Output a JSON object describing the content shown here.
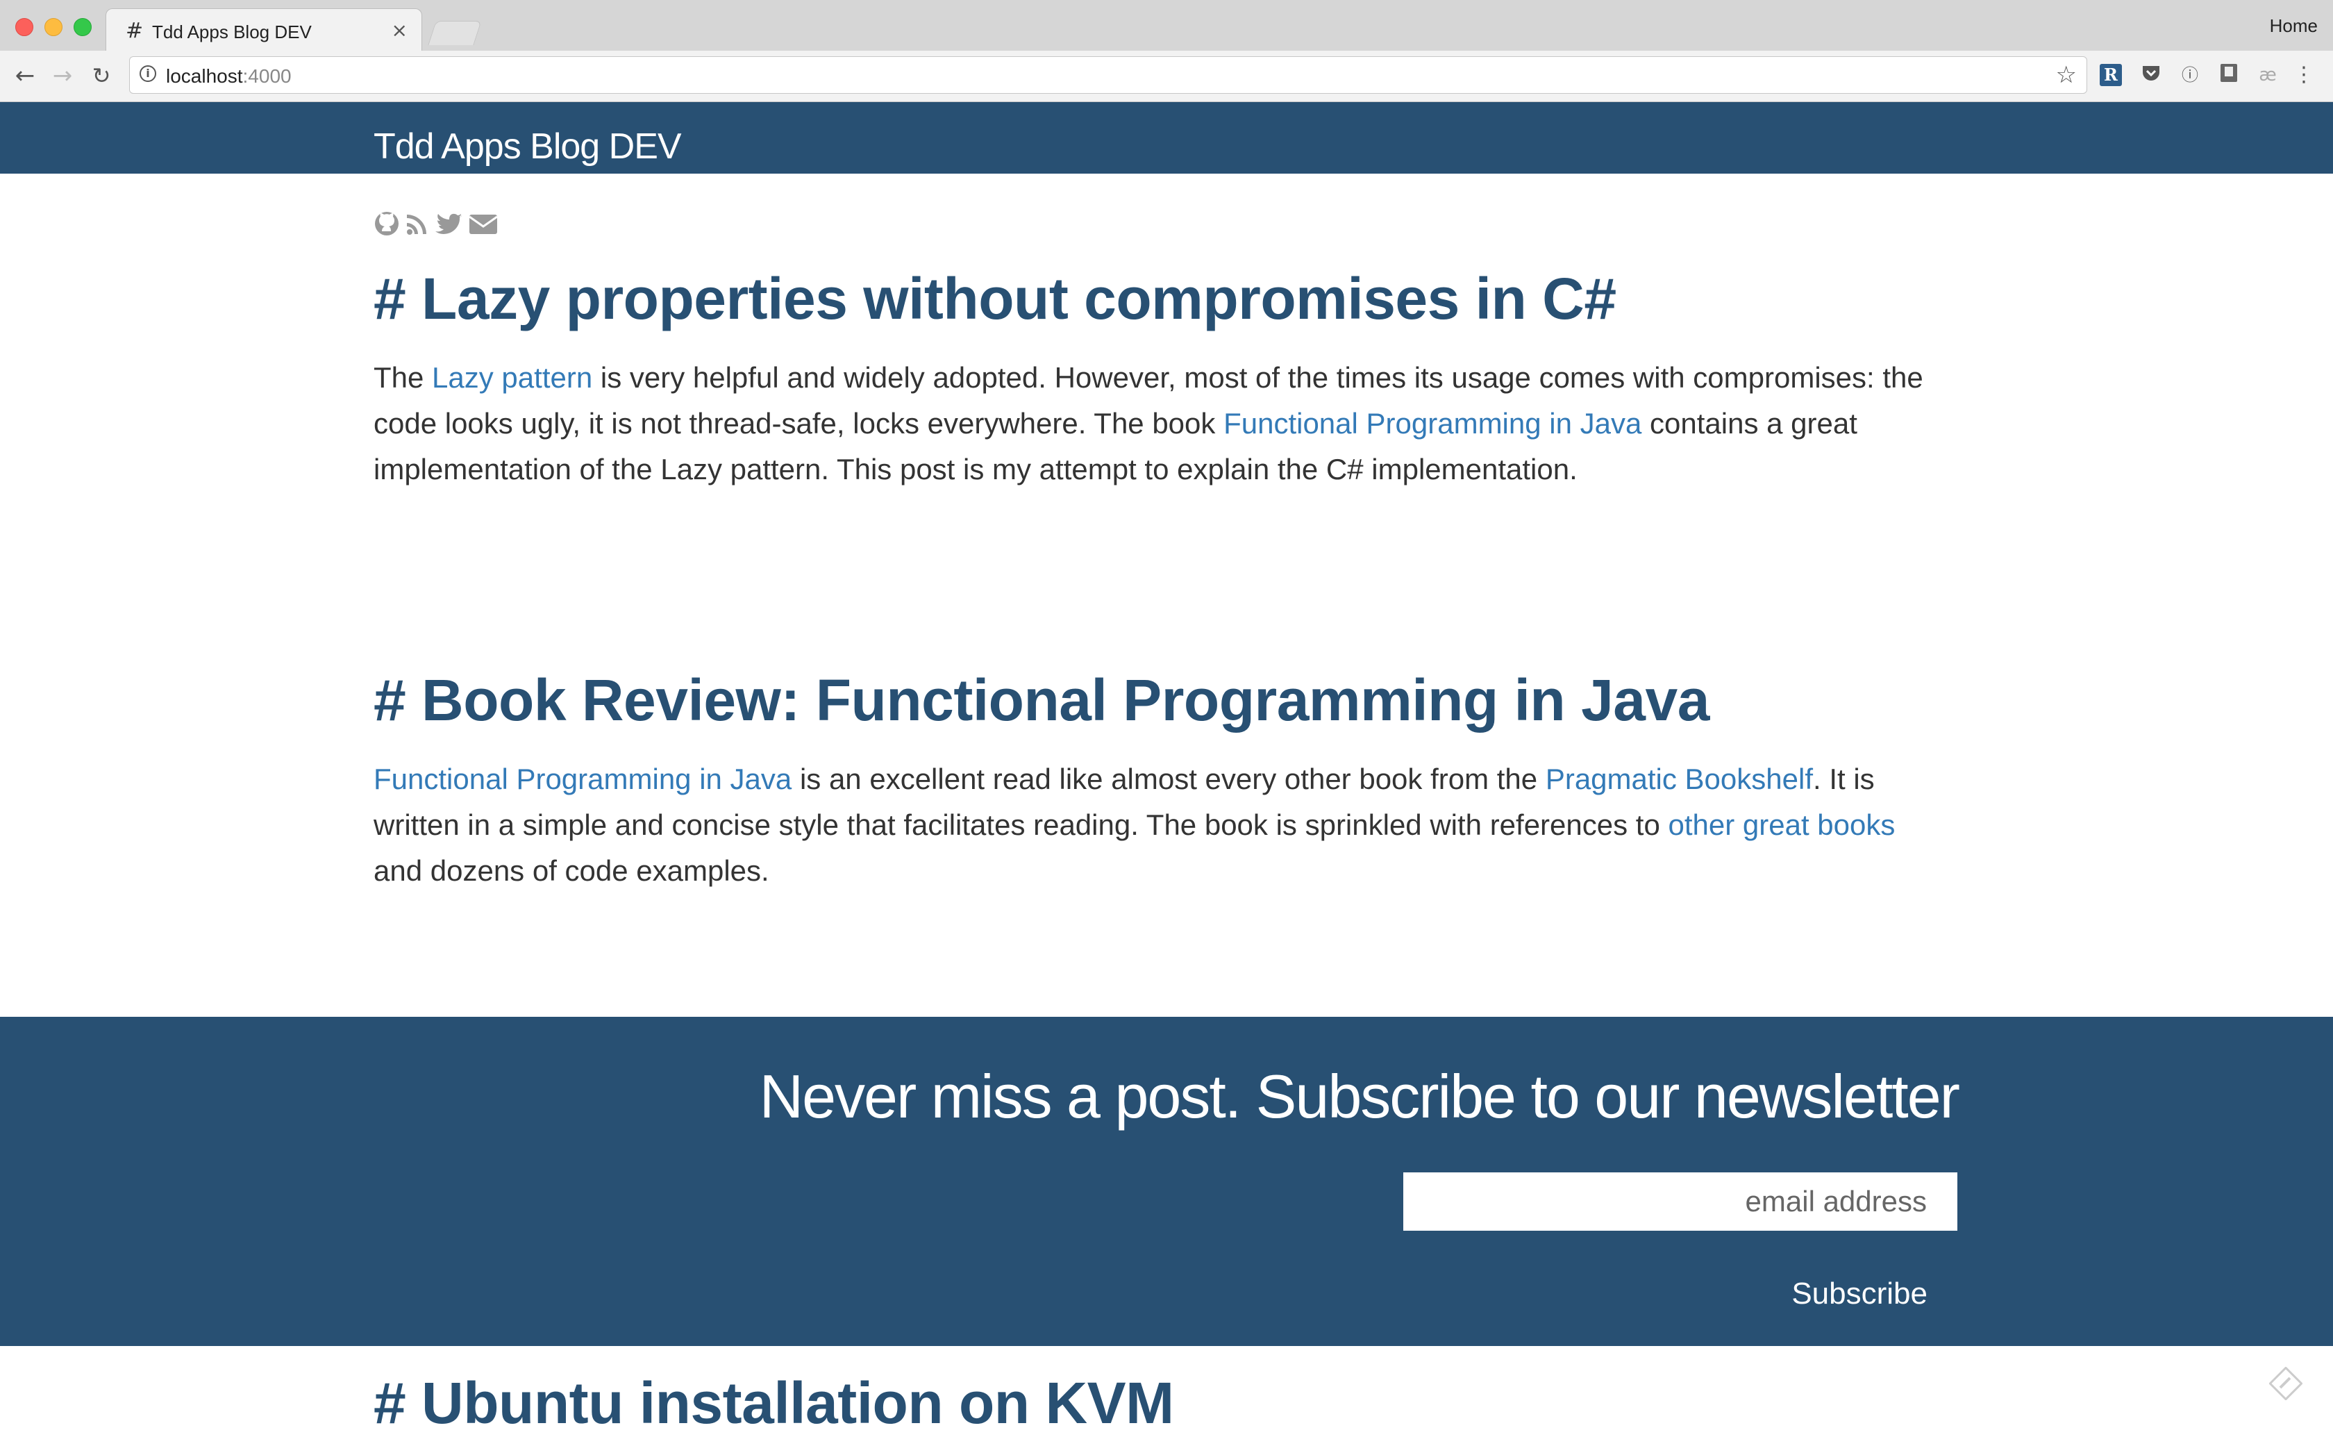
{
  "browser": {
    "tab_favicon": "#",
    "tab_title": "Tdd Apps Blog DEV",
    "tab_close": "×",
    "profile_label": "Home",
    "url_host": "localhost",
    "url_port": ":4000"
  },
  "site": {
    "title": "Tdd Apps Blog DEV",
    "social_icons": [
      "github-icon",
      "rss-icon",
      "twitter-icon",
      "email-icon"
    ]
  },
  "posts": [
    {
      "title": "# Lazy properties without compromises in C#",
      "excerpt": [
        {
          "text": "The "
        },
        {
          "text": "Lazy pattern",
          "link": true
        },
        {
          "text": " is very helpful and widely adopted. However, most of the times its usage comes with compromises: the code looks ugly, it is not thread-safe, locks everywhere. The book "
        },
        {
          "text": "Functional Programming in Java",
          "link": true
        },
        {
          "text": " contains a great implementation of the Lazy pattern. This post is my attempt to explain the C# implementation."
        }
      ]
    },
    {
      "title": "# Book Review: Functional Programming in Java",
      "excerpt": [
        {
          "text": "Functional Programming in Java",
          "link": true
        },
        {
          "text": " is an excellent read like almost every other book from the "
        },
        {
          "text": "Pragmatic Bookshelf",
          "link": true
        },
        {
          "text": ". It is written in a simple and concise style that facilitates reading. The book is sprinkled with references to "
        },
        {
          "text": "other great books",
          "link": true
        },
        {
          "text": " and dozens of code examples."
        }
      ]
    },
    {
      "title": "# Ubuntu installation on KVM"
    }
  ],
  "newsletter": {
    "heading": "Never miss a post. Subscribe to our newsletter",
    "email_placeholder": "email address",
    "email_value": "",
    "subscribe_label": "Subscribe"
  },
  "colors": {
    "header_bg": "#285073",
    "link": "#337ab7",
    "title": "#285073",
    "body_text": "#333333"
  }
}
